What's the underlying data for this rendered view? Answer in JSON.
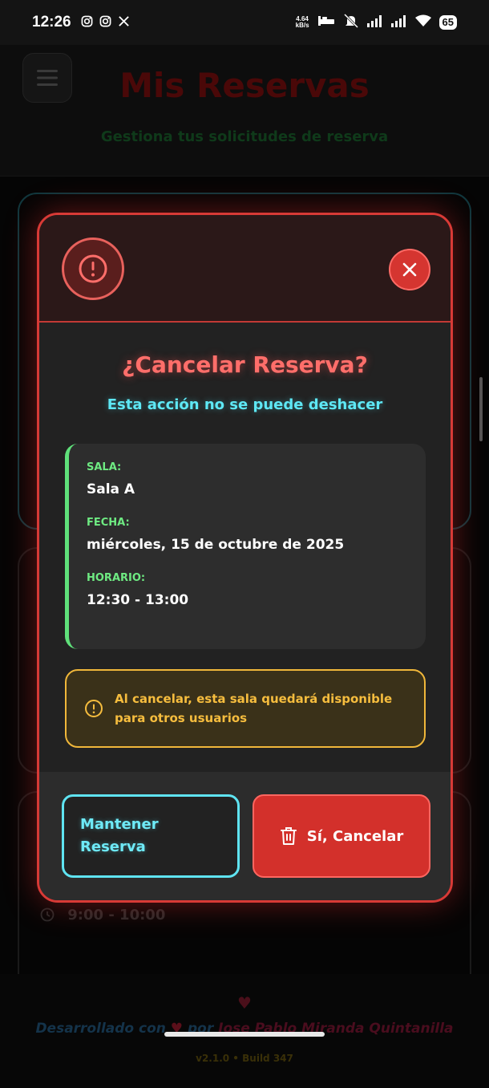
{
  "status_bar": {
    "time": "12:26",
    "net_speed_value": "4.64",
    "net_speed_unit": "kB/s",
    "battery": "65",
    "left_icons": [
      "instagram-icon",
      "instagram-icon",
      "x-icon"
    ],
    "right_icons": [
      "bed-icon",
      "mute-icon",
      "signal-icon",
      "signal-icon",
      "wifi-icon",
      "battery-icon"
    ]
  },
  "background_page": {
    "title": "Mis Reservas",
    "subtitle": "Gestiona tus solicitudes de reserva",
    "visible_time": "9:00 - 10:00",
    "footer": {
      "credit_prefix": "Desarrollado con",
      "credit_middle": "por",
      "author": "Jose Pablo Miranda Quintanilla",
      "version": "v2.1.0 • Build 347"
    }
  },
  "modal": {
    "title": "¿Cancelar Reserva?",
    "subtitle": "Esta acción no se puede deshacer",
    "details": {
      "room_label": "SALA:",
      "room_value": "Sala A",
      "date_label": "FECHA:",
      "date_value": "miércoles, 15 de octubre de 2025",
      "time_label": "HORARIO:",
      "time_value": "12:30 - 13:00"
    },
    "notice": "Al cancelar, esta sala quedará disponible para otros usuarios",
    "keep_button": "Mantener Reserva",
    "cancel_button": "Sí, Cancelar"
  },
  "colors": {
    "danger": "#d3302b",
    "accent_cyan": "#5ee8f5",
    "accent_green": "#6eea82",
    "warning": "#f6bd3e"
  }
}
